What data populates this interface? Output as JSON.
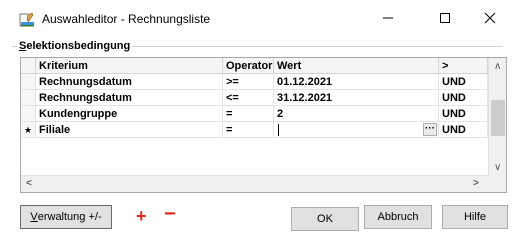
{
  "window": {
    "title": "Auswahleditor - Rechnungsliste",
    "minimize_glyph": "—",
    "maximize_glyph": "☐",
    "close_glyph": "✕"
  },
  "group": {
    "label_accesskey": "S",
    "label_rest": "elektionsbedingung"
  },
  "grid": {
    "columns": [
      "Kriterium",
      "Operator",
      "Wert",
      ">"
    ],
    "rows": [
      {
        "marker": "",
        "kriterium": "Rechnungsdatum",
        "operator": ">=",
        "wert": "01.12.2021",
        "verknuepfung": "UND"
      },
      {
        "marker": "",
        "kriterium": "Rechnungsdatum",
        "operator": "<=",
        "wert": "31.12.2021",
        "verknuepfung": "UND"
      },
      {
        "marker": "",
        "kriterium": "Kundengruppe",
        "operator": "=",
        "wert": "2",
        "verknuepfung": "UND"
      },
      {
        "marker": "★",
        "kriterium": "Filiale",
        "operator": "=",
        "wert": "",
        "verknuepfung": "UND"
      }
    ],
    "ellipsis_label": "···",
    "scroll_up": "∧",
    "scroll_down": "∨",
    "scroll_left": "<",
    "scroll_right": ">"
  },
  "buttons": {
    "verwaltung_accesskey": "V",
    "verwaltung_rest": "erwaltung +/-",
    "plus": "+",
    "minus": "−",
    "ok": "OK",
    "abbruch": "Abbruch",
    "hilfe": "Hilfe"
  },
  "colors": {
    "accent_red": "#e0281e"
  }
}
